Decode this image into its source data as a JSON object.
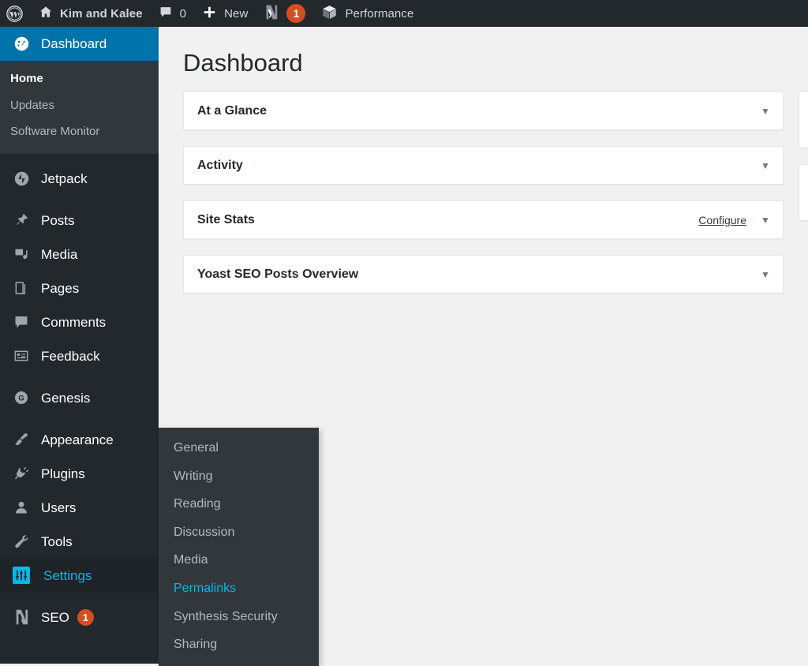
{
  "adminbar": {
    "items": [
      {
        "name": "wp-logo",
        "icon": "wordpress-logo-icon",
        "label": ""
      },
      {
        "name": "site-name",
        "icon": "home-icon",
        "label": "Kim and Kalee"
      },
      {
        "name": "comments",
        "icon": "comment-icon",
        "label": "0"
      },
      {
        "name": "new-content",
        "icon": "plus-icon",
        "label": "New"
      },
      {
        "name": "yoast-seo",
        "icon": "yoast-logo-icon",
        "label": "",
        "badge": "1"
      },
      {
        "name": "performance",
        "icon": "cube-icon",
        "label": "Performance"
      }
    ]
  },
  "sidebar": {
    "items": [
      {
        "label": "Dashboard",
        "icon": "dashboard-gauge-icon",
        "state": "current"
      },
      {
        "label": "Jetpack",
        "icon": "jetpack-icon",
        "state": "normal"
      },
      {
        "label": "Posts",
        "icon": "pin-icon",
        "state": "normal"
      },
      {
        "label": "Media",
        "icon": "media-icon",
        "state": "normal"
      },
      {
        "label": "Pages",
        "icon": "pages-icon",
        "state": "normal"
      },
      {
        "label": "Comments",
        "icon": "comment-icon",
        "state": "normal"
      },
      {
        "label": "Feedback",
        "icon": "feedback-icon",
        "state": "normal"
      },
      {
        "label": "Genesis",
        "icon": "genesis-g-icon",
        "state": "normal"
      },
      {
        "label": "Appearance",
        "icon": "paintbrush-icon",
        "state": "normal"
      },
      {
        "label": "Plugins",
        "icon": "plug-icon",
        "state": "normal"
      },
      {
        "label": "Users",
        "icon": "user-icon",
        "state": "normal"
      },
      {
        "label": "Tools",
        "icon": "wrench-icon",
        "state": "normal"
      },
      {
        "label": "Settings",
        "icon": "settings-sliders-icon",
        "state": "open-parent"
      },
      {
        "label": "SEO",
        "icon": "yoast-logo-icon",
        "state": "normal",
        "badge": "1"
      }
    ],
    "dashboard_submenu": [
      {
        "label": "Home",
        "state": "current"
      },
      {
        "label": "Updates",
        "state": "normal"
      },
      {
        "label": "Software Monitor",
        "state": "normal"
      }
    ],
    "settings_flyout": [
      {
        "label": "General",
        "state": "normal"
      },
      {
        "label": "Writing",
        "state": "normal"
      },
      {
        "label": "Reading",
        "state": "normal"
      },
      {
        "label": "Discussion",
        "state": "normal"
      },
      {
        "label": "Media",
        "state": "normal"
      },
      {
        "label": "Permalinks",
        "state": "current"
      },
      {
        "label": "Synthesis Security",
        "state": "normal"
      },
      {
        "label": "Sharing",
        "state": "normal"
      }
    ]
  },
  "main": {
    "page_title": "Dashboard",
    "widgets": [
      {
        "title": "At a Glance",
        "configure": "",
        "toggle": "▼"
      },
      {
        "title": "Activity",
        "configure": "",
        "toggle": "▼"
      },
      {
        "title": "Site Stats",
        "configure": "Configure",
        "toggle": "▼"
      },
      {
        "title": "Yoast SEO Posts Overview",
        "configure": "",
        "toggle": "▼"
      }
    ]
  },
  "colors": {
    "accent": "#0073aa",
    "accent_light": "#00b9eb",
    "sidebar_bg": "#23282d",
    "submenu_bg": "#32373c",
    "badge": "#d54e21",
    "content_bg": "#f1f1f1"
  }
}
